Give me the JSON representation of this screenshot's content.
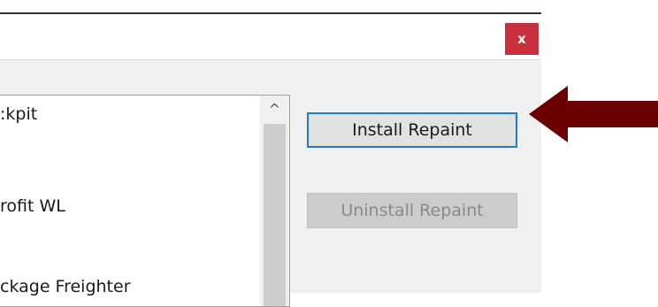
{
  "window": {
    "close_label": "x"
  },
  "list": {
    "items": [
      {
        "label": ":kpit"
      },
      {
        "label": "rofit WL"
      },
      {
        "label": "ckage Freighter"
      }
    ],
    "scroll_up_glyph": "^"
  },
  "buttons": {
    "install_label": "Install Repaint",
    "uninstall_label": "Uninstall Repaint"
  },
  "colors": {
    "close_bg": "#c9303e",
    "focus_border": "#1c7bd4",
    "arrow": "#6b0000"
  },
  "icons": {
    "close": "close-icon",
    "scroll_up": "chevron-up-icon",
    "annotation": "left-arrow-icon"
  }
}
